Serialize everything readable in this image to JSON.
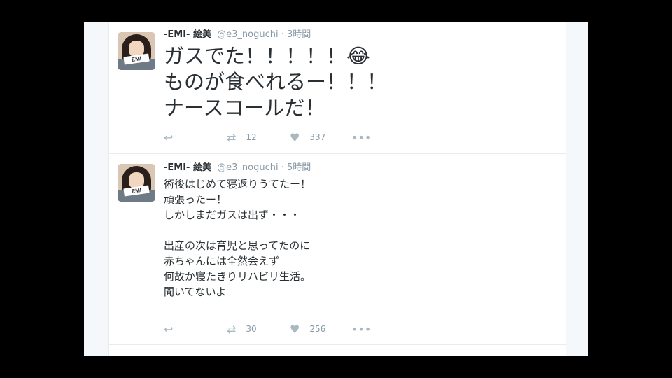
{
  "tweets": [
    {
      "avatar_tag": "EMI",
      "name": "-EMI- 絵美",
      "handle": "@e3_noguchi",
      "separator": "·",
      "time": "3時間",
      "text": "ガスでた！！！！！😂\nものが食べれるー！！！\nナースコールだ！",
      "retweets": "12",
      "likes": "337",
      "icons": {
        "reply": "reply-icon",
        "retweet": "retweet-icon",
        "like": "heart-icon",
        "more": "more-icon"
      }
    },
    {
      "avatar_tag": "EMI",
      "name": "-EMI- 絵美",
      "handle": "@e3_noguchi",
      "separator": "·",
      "time": "5時間",
      "text": "術後はじめて寝返りうてたー！\n頑張ったー！\nしかしまだガスは出ず・・・\n\n出産の次は育児と思ってたのに\n赤ちゃんには全然会えず\n何故か寝たきりリハビリ生活。\n聞いてないよ",
      "retweets": "30",
      "likes": "256",
      "icons": {
        "reply": "reply-icon",
        "retweet": "retweet-icon",
        "like": "heart-icon",
        "more": "more-icon"
      }
    }
  ]
}
